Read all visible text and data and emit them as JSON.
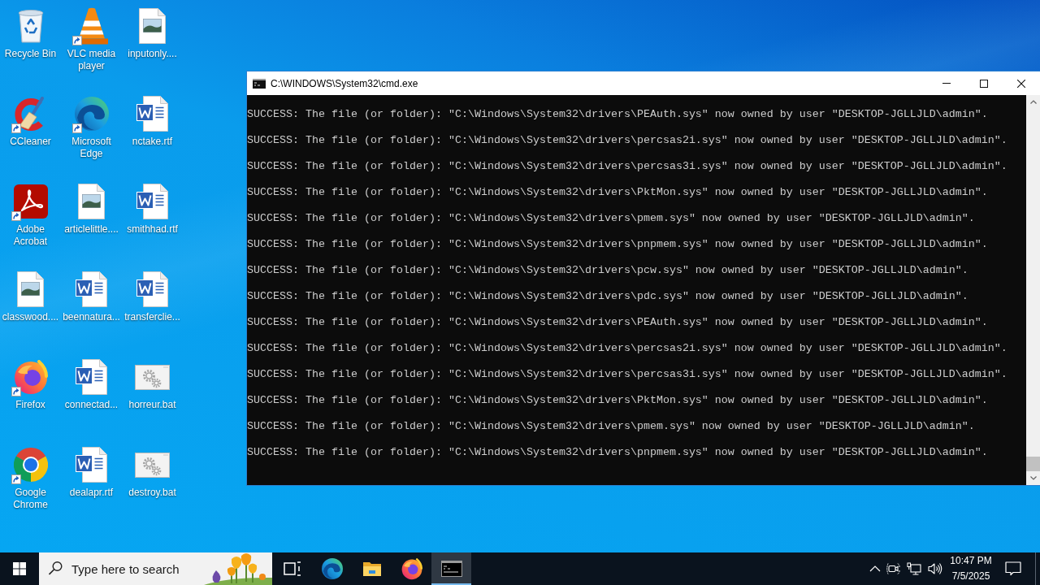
{
  "desktop": {
    "icons": [
      {
        "label": "Recycle Bin",
        "kind": "recycle-bin",
        "shortcut": false
      },
      {
        "label": "VLC media player",
        "kind": "vlc",
        "shortcut": true
      },
      {
        "label": "inputonly....",
        "kind": "image-file",
        "shortcut": false
      },
      {
        "label": "CCleaner",
        "kind": "ccleaner",
        "shortcut": true
      },
      {
        "label": "Microsoft Edge",
        "kind": "edge",
        "shortcut": true
      },
      {
        "label": "nctake.rtf",
        "kind": "word-file",
        "shortcut": false
      },
      {
        "label": "Adobe Acrobat",
        "kind": "acrobat",
        "shortcut": true
      },
      {
        "label": "articlelittle....",
        "kind": "image-file",
        "shortcut": false
      },
      {
        "label": "smithhad.rtf",
        "kind": "word-file",
        "shortcut": false
      },
      {
        "label": "classwood....",
        "kind": "image-file",
        "shortcut": false
      },
      {
        "label": "beennatura...",
        "kind": "word-file",
        "shortcut": false
      },
      {
        "label": "transferclie...",
        "kind": "word-file",
        "shortcut": false
      },
      {
        "label": "Firefox",
        "kind": "firefox",
        "shortcut": true
      },
      {
        "label": "connectad...",
        "kind": "word-file",
        "shortcut": false
      },
      {
        "label": "horreur.bat",
        "kind": "batch-file",
        "shortcut": false
      },
      {
        "label": "Google Chrome",
        "kind": "chrome",
        "shortcut": true
      },
      {
        "label": "dealapr.rtf",
        "kind": "word-file",
        "shortcut": false
      },
      {
        "label": "destroy.bat",
        "kind": "batch-file",
        "shortcut": false
      }
    ]
  },
  "console_window": {
    "title": "C:\\WINDOWS\\System32\\cmd.exe",
    "output_blocks": [
      {
        "lines": [
          "SUCCESS: The file (or folder): \"C:\\Windows\\System32\\drivers\\PEAuth.sys\" now owned by user \"DESKTOP-JGLLJLD\\admin\".",
          "SUCCESS: The file (or folder): \"C:\\Windows\\System32\\drivers\\percsas2i.sys\" now owned by user \"DESKTOP-JGLLJLD\\admin\".",
          "SUCCESS: The file (or folder): \"C:\\Windows\\System32\\drivers\\percsas3i.sys\" now owned by user \"DESKTOP-JGLLJLD\\admin\".",
          "SUCCESS: The file (or folder): \"C:\\Windows\\System32\\drivers\\PktMon.sys\" now owned by user \"DESKTOP-JGLLJLD\\admin\".",
          "SUCCESS: The file (or folder): \"C:\\Windows\\System32\\drivers\\pmem.sys\" now owned by user \"DESKTOP-JGLLJLD\\admin\".",
          "SUCCESS: The file (or folder): \"C:\\Windows\\System32\\drivers\\pnpmem.sys\" now owned by user \"DESKTOP-JGLLJLD\\admin\"."
        ]
      },
      {
        "lines": [
          "SUCCESS: The file (or folder): \"C:\\Windows\\System32\\drivers\\pcw.sys\" now owned by user \"DESKTOP-JGLLJLD\\admin\".",
          "SUCCESS: The file (or folder): \"C:\\Windows\\System32\\drivers\\pdc.sys\" now owned by user \"DESKTOP-JGLLJLD\\admin\".",
          "SUCCESS: The file (or folder): \"C:\\Windows\\System32\\drivers\\PEAuth.sys\" now owned by user \"DESKTOP-JGLLJLD\\admin\".",
          "SUCCESS: The file (or folder): \"C:\\Windows\\System32\\drivers\\percsas2i.sys\" now owned by user \"DESKTOP-JGLLJLD\\admin\".",
          "SUCCESS: The file (or folder): \"C:\\Windows\\System32\\drivers\\percsas3i.sys\" now owned by user \"DESKTOP-JGLLJLD\\admin\".",
          "SUCCESS: The file (or folder): \"C:\\Windows\\System32\\drivers\\PktMon.sys\" now owned by user \"DESKTOP-JGLLJLD\\admin\".",
          "SUCCESS: The file (or folder): \"C:\\Windows\\System32\\drivers\\pmem.sys\" now owned by user \"DESKTOP-JGLLJLD\\admin\".",
          "SUCCESS: The file (or folder): \"C:\\Windows\\System32\\drivers\\pnpmem.sys\" now owned by user \"DESKTOP-JGLLJLD\\admin\"."
        ]
      }
    ]
  },
  "taskbar": {
    "search": {
      "placeholder": "Type here to search"
    },
    "apps": [
      {
        "kind": "task-view",
        "selected": false
      },
      {
        "kind": "edge",
        "selected": false
      },
      {
        "kind": "file-explorer",
        "selected": false
      },
      {
        "kind": "firefox",
        "selected": false
      },
      {
        "kind": "terminal",
        "selected": true
      }
    ],
    "clock": {
      "time": "10:47 PM",
      "date": "7/5/2025"
    }
  }
}
